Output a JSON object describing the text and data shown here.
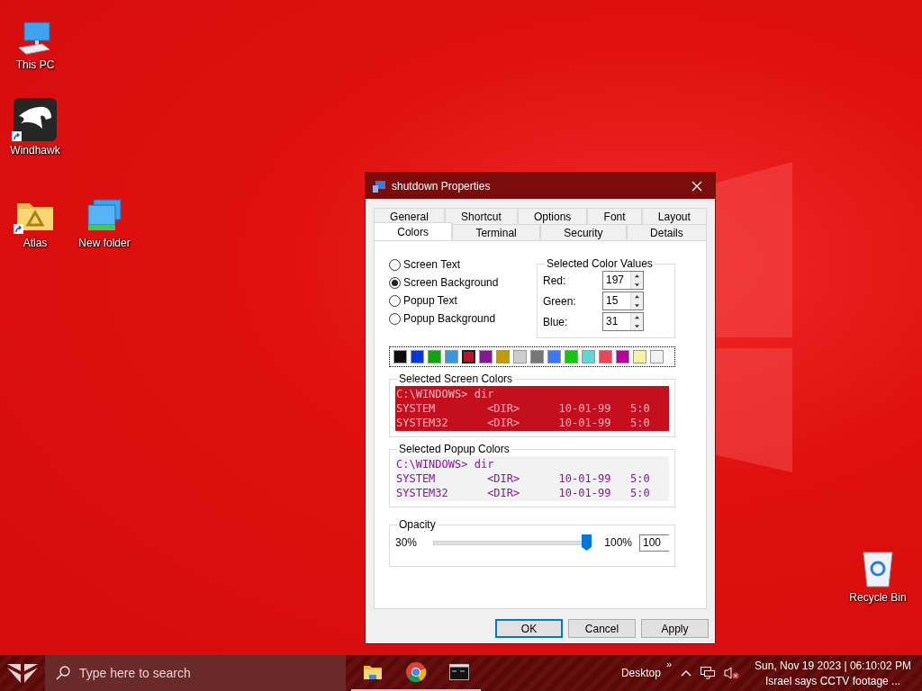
{
  "desktop_icons": [
    {
      "label": "This PC",
      "kind": "pc",
      "shortcut": false
    },
    {
      "label": "Windhawk",
      "kind": "app",
      "shortcut": true
    },
    {
      "label": "Atlas",
      "kind": "folder",
      "shortcut": true
    },
    {
      "label": "New folder",
      "kind": "network",
      "shortcut": false
    },
    {
      "label": "Recycle Bin",
      "kind": "bin",
      "shortcut": false
    }
  ],
  "dialog": {
    "title": "shutdown Properties",
    "tab_rows": [
      {
        "tabs": [
          {
            "label": "General",
            "selected": false
          },
          {
            "label": "Shortcut",
            "selected": false
          },
          {
            "label": "Options",
            "selected": false
          },
          {
            "label": "Font",
            "selected": false
          },
          {
            "label": "Layout",
            "selected": false
          }
        ]
      },
      {
        "tabs": [
          {
            "label": "Colors",
            "selected": true
          },
          {
            "label": "Terminal",
            "selected": false
          },
          {
            "label": "Security",
            "selected": false
          },
          {
            "label": "Details",
            "selected": false
          }
        ]
      }
    ],
    "color_targets": [
      {
        "label": "Screen Text",
        "selected": false
      },
      {
        "label": "Screen Background",
        "selected": true
      },
      {
        "label": "Popup Text",
        "selected": false
      },
      {
        "label": "Popup Background",
        "selected": false
      }
    ],
    "color_values": {
      "title": "Selected Color Values",
      "fields": [
        {
          "label": "Red:",
          "value": "197"
        },
        {
          "label": "Green:",
          "value": "15"
        },
        {
          "label": "Blue:",
          "value": "31"
        }
      ]
    },
    "palette": [
      {
        "color": "#0c0c0c",
        "selected": false
      },
      {
        "color": "#0037da",
        "selected": false
      },
      {
        "color": "#13a10e",
        "selected": false
      },
      {
        "color": "#3a96dd",
        "selected": false
      },
      {
        "color": "#c50f1f",
        "selected": true
      },
      {
        "color": "#881798",
        "selected": false
      },
      {
        "color": "#c19c00",
        "selected": false
      },
      {
        "color": "#cccccc",
        "selected": false
      },
      {
        "color": "#767676",
        "selected": false
      },
      {
        "color": "#3b78ff",
        "selected": false
      },
      {
        "color": "#16c60c",
        "selected": false
      },
      {
        "color": "#61d6d6",
        "selected": false
      },
      {
        "color": "#e74856",
        "selected": false
      },
      {
        "color": "#b4009e",
        "selected": false
      },
      {
        "color": "#f9f1a5",
        "selected": false
      },
      {
        "color": "#f2f2f2",
        "selected": false
      }
    ],
    "screen_preview": {
      "title": "Selected Screen Colors",
      "lines": [
        "C:\\WINDOWS> dir",
        "SYSTEM        <DIR>      10-01-99   5:0",
        "SYSTEM32      <DIR>      10-01-99   5:0"
      ]
    },
    "popup_preview": {
      "title": "Selected Popup Colors",
      "lines": [
        "C:\\WINDOWS> dir",
        "SYSTEM        <DIR>      10-01-99   5:0",
        "SYSTEM32      <DIR>      10-01-99   5:0"
      ]
    },
    "opacity": {
      "title": "Opacity",
      "min_label": "30%",
      "max_label": "100%",
      "level": 1,
      "value": "100"
    },
    "buttons": [
      {
        "label": "OK",
        "default": true
      },
      {
        "label": "Cancel",
        "default": false
      },
      {
        "label": "Apply",
        "default": false
      }
    ]
  },
  "taskbar": {
    "search_placeholder": "Type here to search",
    "apps": [
      {
        "kind": "folder",
        "running": true
      },
      {
        "kind": "browser",
        "running": true
      },
      {
        "kind": "terminal",
        "running": true
      }
    ],
    "toolbar_label": "Desktop",
    "toolbar_more": "»",
    "clock": "Sun, Nov 19 2023 | 06:10:02 PM",
    "news": "Israel says CCTV footage ..."
  }
}
